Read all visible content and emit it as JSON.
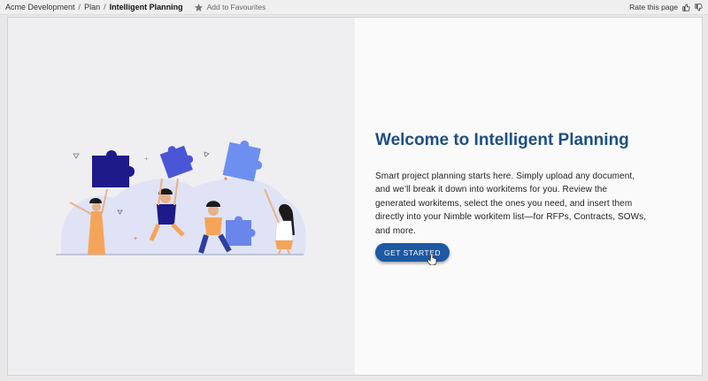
{
  "breadcrumb": {
    "items": [
      "Acme Development",
      "Plan",
      "Intelligent Planning"
    ],
    "separator": "/"
  },
  "favourites": {
    "label": "Add to Favourites",
    "icon": "star-icon"
  },
  "rating": {
    "label": "Rate this page",
    "up_icon": "thumbs-up-icon",
    "down_icon": "thumbs-down-icon"
  },
  "welcome": {
    "title": "Welcome to Intelligent Planning",
    "description": "Smart project planning starts here. Simply upload any document, and we’ll break it down into workitems for you. Review the generated workitems, select the ones you need, and insert them directly into your Nimble workitem list—for RFPs, Contracts, SOWs, and more.",
    "cta_label": "GET STARTED"
  },
  "illustration": {
    "icon": "puzzle-team-illustration"
  },
  "colors": {
    "accent": "#1d58a3",
    "title": "#1e4f82",
    "puzzle_dark": "#1f1a8a",
    "puzzle_light": "#5b7ce8"
  }
}
